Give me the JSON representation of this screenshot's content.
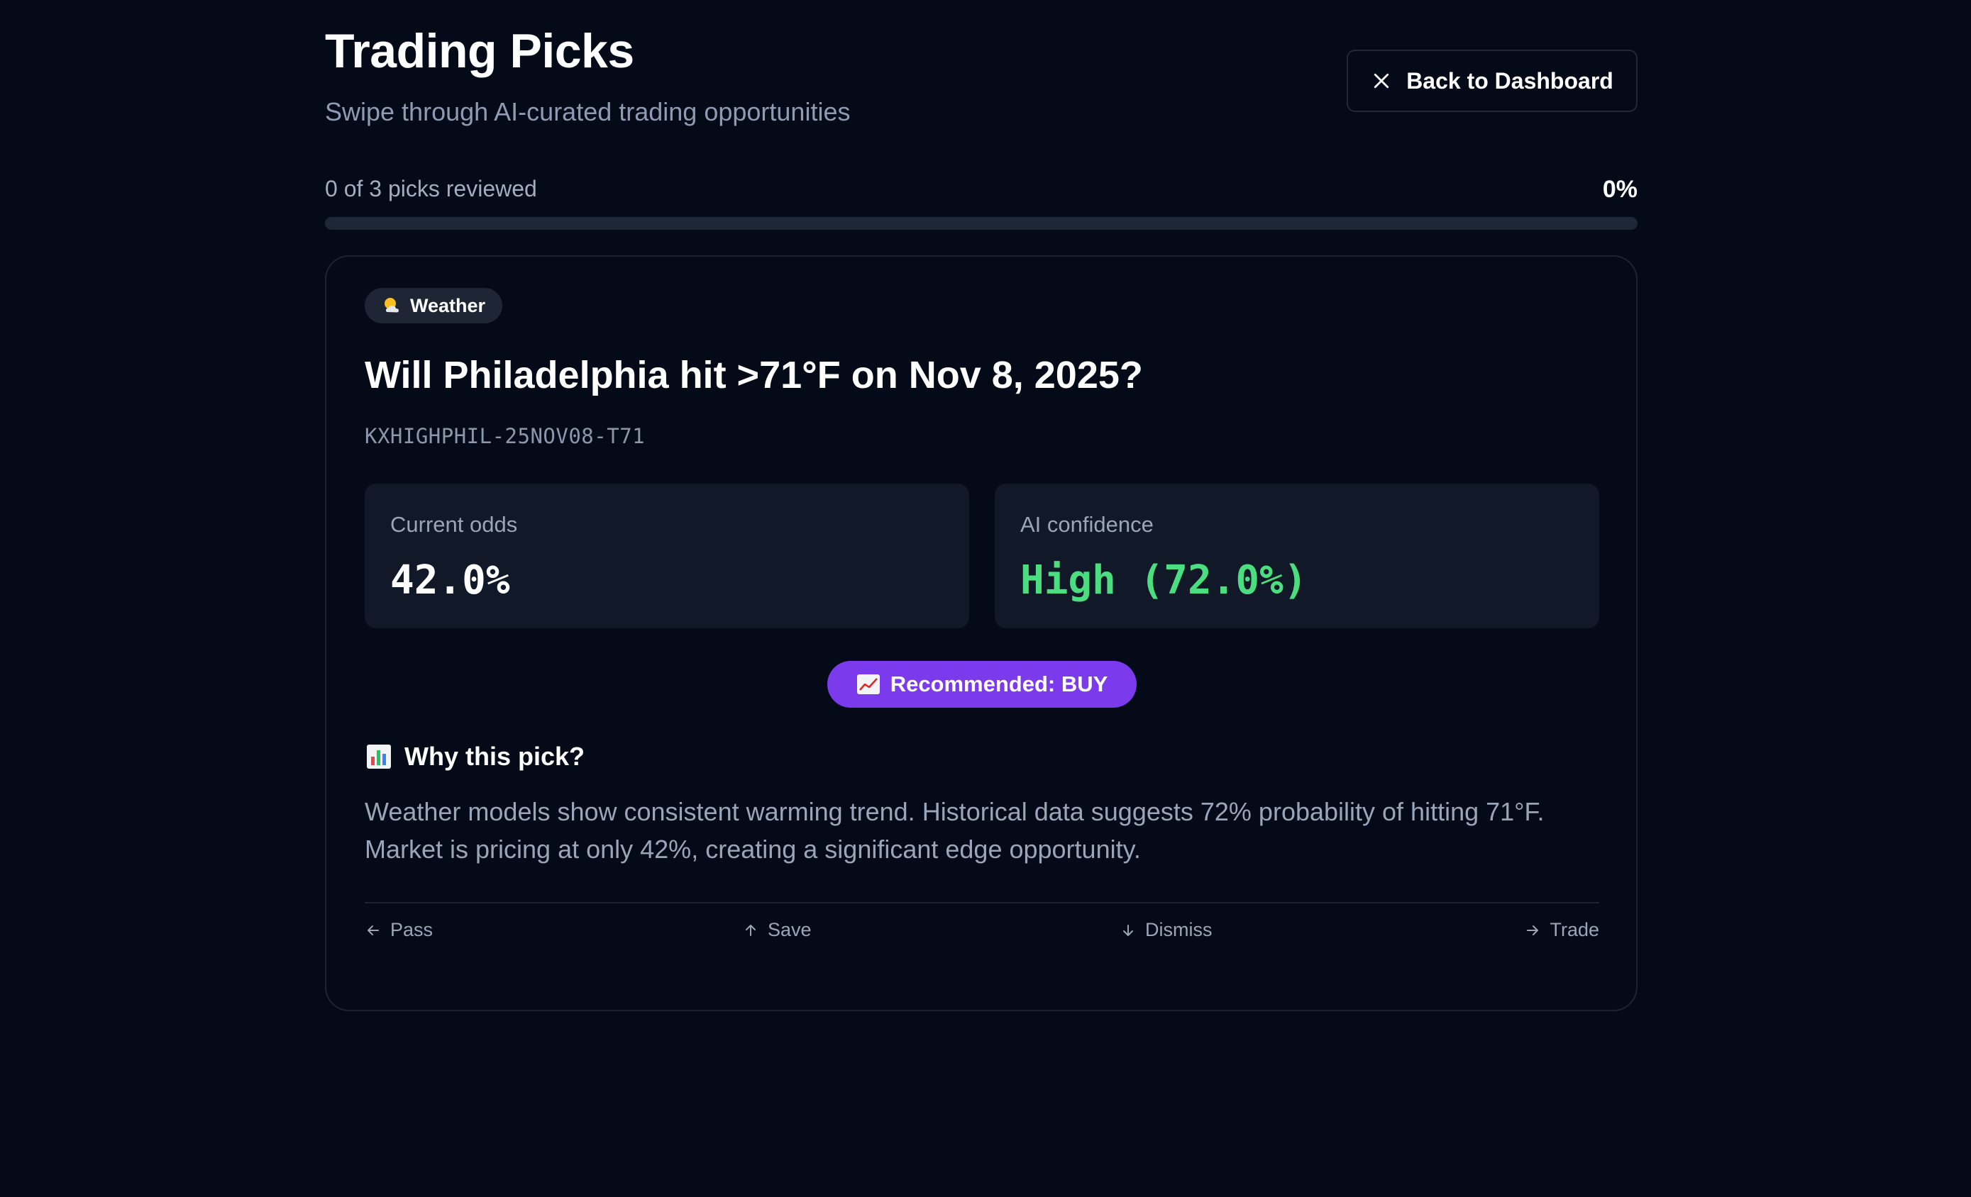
{
  "header": {
    "title": "Trading Picks",
    "subtitle": "Swipe through AI-curated trading opportunities",
    "back_button_label": "Back to Dashboard"
  },
  "progress": {
    "label": "0 of 3 picks reviewed",
    "percent_label": "0%",
    "reviewed": 0,
    "total": 3,
    "fraction": 0
  },
  "card": {
    "category": "Weather",
    "category_icon": "sun-behind-cloud-icon",
    "question": "Will Philadelphia hit >71°F on Nov 8, 2025?",
    "ticker": "KXHIGHPHIL-25NOV08-T71",
    "current_odds": {
      "label": "Current odds",
      "value": "42.0%"
    },
    "ai_confidence": {
      "label": "AI confidence",
      "value": "High (72.0%)",
      "color": "#4ade80"
    },
    "recommendation": {
      "label": "Recommended: BUY",
      "icon": "chart-increasing-icon",
      "color": "#7c3aed"
    },
    "why": {
      "heading": "Why this pick?",
      "icon": "bar-chart-icon",
      "text": "Weather models show consistent warming trend. Historical data suggests 72% probability of hitting 71°F. Market is pricing at only 42%, creating a significant edge opportunity."
    },
    "actions": {
      "pass": "Pass",
      "save": "Save",
      "dismiss": "Dismiss",
      "trade": "Trade"
    }
  },
  "colors": {
    "background": "#050a18",
    "accent": "#7c3aed",
    "positive": "#4ade80"
  }
}
